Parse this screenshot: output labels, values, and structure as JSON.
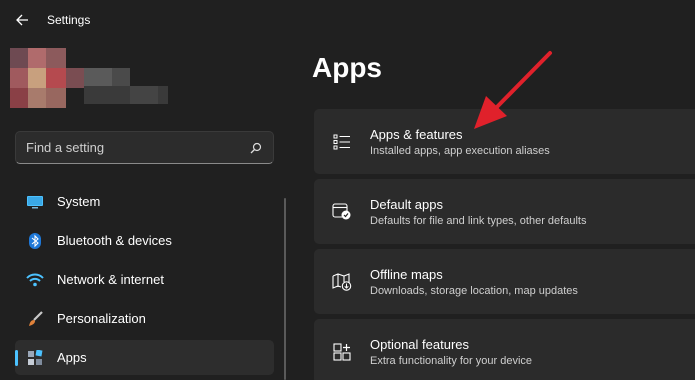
{
  "window": {
    "title": "Settings"
  },
  "search": {
    "placeholder": "Find a setting"
  },
  "sidebar": {
    "items": [
      {
        "label": "System",
        "icon": "monitor-icon"
      },
      {
        "label": "Bluetooth & devices",
        "icon": "bluetooth-icon"
      },
      {
        "label": "Network & internet",
        "icon": "wifi-icon"
      },
      {
        "label": "Personalization",
        "icon": "brush-icon"
      },
      {
        "label": "Apps",
        "icon": "apps-icon",
        "selected": true
      }
    ]
  },
  "main": {
    "title": "Apps",
    "cards": [
      {
        "title": "Apps & features",
        "description": "Installed apps, app execution aliases",
        "icon": "list-icon"
      },
      {
        "title": "Default apps",
        "description": "Defaults for file and link types, other defaults",
        "icon": "default-apps-icon"
      },
      {
        "title": "Offline maps",
        "description": "Downloads, storage location, map updates",
        "icon": "map-download-icon"
      },
      {
        "title": "Optional features",
        "description": "Extra functionality for your device",
        "icon": "optional-features-icon"
      }
    ]
  },
  "colors": {
    "accent": "#4cc2ff",
    "background": "#202020",
    "card": "#2b2b2b",
    "annotation_arrow": "#e0212b"
  }
}
